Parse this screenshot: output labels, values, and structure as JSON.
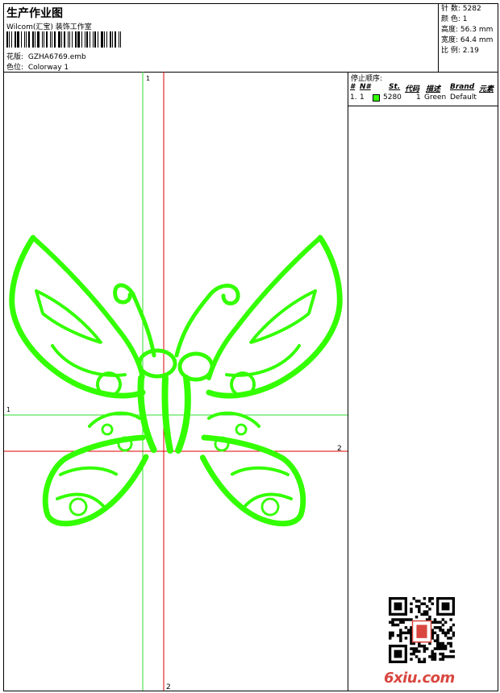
{
  "header": {
    "title": "生产作业图",
    "subtitle": "Wilcom(汇宝) 装饰工作室",
    "design_label": "花版:",
    "design_value": "GZHA6769.emb",
    "colorway_label": "色位:",
    "colorway_value": "Colorway 1"
  },
  "stats": {
    "stitches_label": "针 数:",
    "stitches_value": "5282",
    "colors_label": "颜 色:",
    "colors_value": "1",
    "height_label": "高度:",
    "height_value": "56.3 mm",
    "width_label": "宽度:",
    "width_value": "64.4 mm",
    "ratio_label": "比 例:",
    "ratio_value": "2.19"
  },
  "stop_sequence": {
    "title": "停止顺序:",
    "headers": [
      "#",
      "N#",
      "St.",
      "代码",
      "描述",
      "Brand",
      "元素"
    ],
    "rows": [
      {
        "index": "1.",
        "n": "1",
        "stitches": "5280",
        "code": "1",
        "desc": "Green",
        "brand": "Default",
        "color": "#33ff00"
      }
    ]
  },
  "crosshair": {
    "v1_label": "1",
    "h1_label": "1",
    "h2_label": "2",
    "v2_label": "2",
    "v1_color": "#33dd33",
    "v2_color": "#dd0000"
  },
  "design_color": "#33ff00",
  "watermark": "6xiu.com"
}
